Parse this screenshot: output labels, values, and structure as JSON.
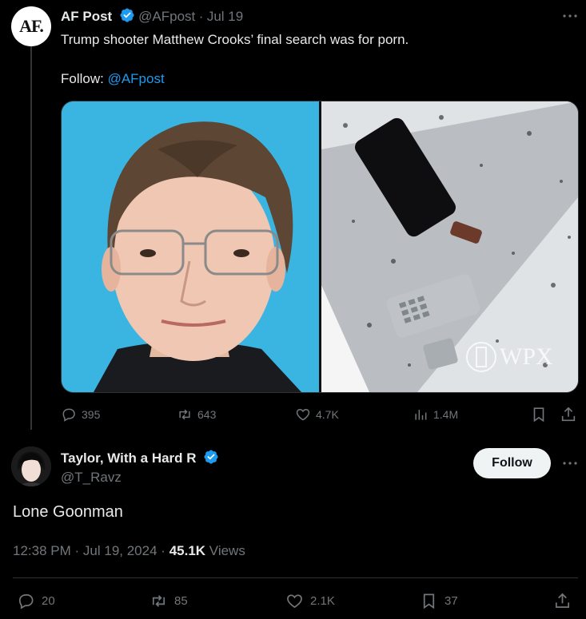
{
  "tweet1": {
    "avatar_text": "AF.",
    "name": "AF Post",
    "handle": "@AFpost",
    "sep": "·",
    "date": "Jul 19",
    "text": "Trump shooter Matthew Crooks’ final search was for porn.",
    "follow_prefix": "Follow: ",
    "follow_link": "@AFpost",
    "watermark": "WPX",
    "replies": "395",
    "reposts": "643",
    "likes": "4.7K",
    "views": "1.4M"
  },
  "tweet2": {
    "name": "Taylor, With a Hard R",
    "handle": "@T_Ravz",
    "follow_label": "Follow",
    "text": "Lone Goonman",
    "time": "12:38 PM",
    "date_sep": "·",
    "date": "Jul 19, 2024",
    "views_sep": "·",
    "views_count": "45.1K",
    "views_label": "Views",
    "replies": "20",
    "reposts": "85",
    "likes": "2.1K",
    "bookmarks": "37"
  },
  "colors": {
    "background": "#000000",
    "accent": "#1d9bf0",
    "muted": "#71767b",
    "text": "#e7e9ea",
    "verified": "#1d9bf0"
  },
  "icons": [
    "more-icon",
    "verified-icon",
    "reply-icon",
    "repost-icon",
    "like-icon",
    "views-icon",
    "bookmark-icon",
    "share-icon"
  ]
}
